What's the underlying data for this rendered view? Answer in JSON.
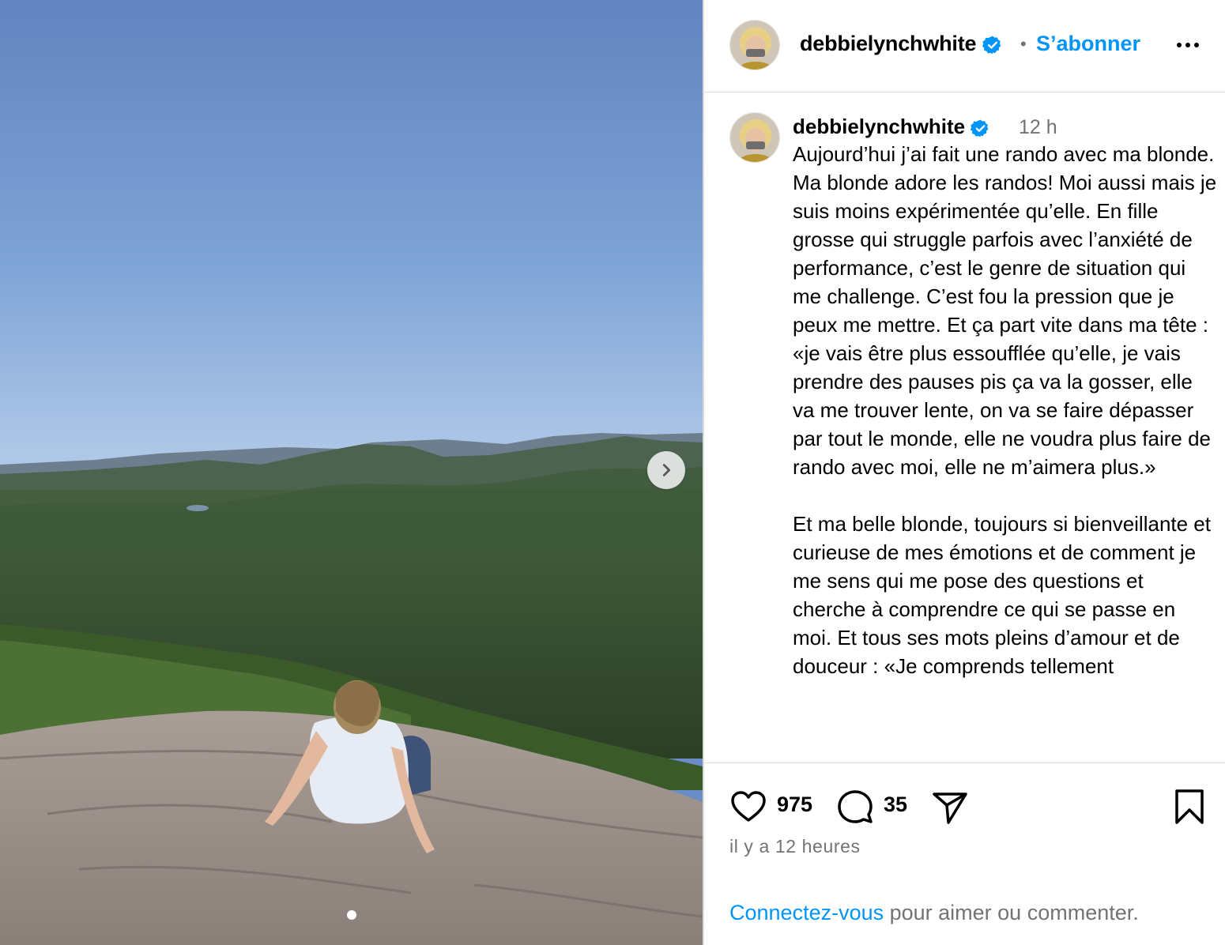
{
  "post": {
    "username": "debbielynchwhite",
    "follow_label": "S’abonner",
    "header_separator": "•",
    "time_short": "12 h",
    "caption_paragraphs": [
      "Aujourd’hui j’ai fait une rando avec ma blonde. Ma blonde adore les randos! Moi aussi mais je suis moins expérimentée qu’elle.  En fille grosse qui struggle parfois avec l’anxiété de performance, c’est le genre de situation qui me challenge. C’est fou la pression que je peux me mettre. Et ça part vite dans ma tête : «je vais être plus essoufflée qu’elle, je vais prendre des pauses pis ça va la gosser, elle va me trouver lente, on va se faire dépasser par tout le monde, elle ne voudra plus faire de rando avec moi, elle ne m’aimera plus.»",
      "Et ma belle blonde, toujours si bienveillante et curieuse de mes émotions et de comment je me sens qui me pose des questions et cherche à comprendre ce qui se passe en moi. Et tous ses mots pleins d’amour et de douceur : «Je comprends tellement"
    ],
    "likes": "975",
    "comments": "35",
    "time_ago": "il y a 12 heures",
    "login_link": "Connectez-vous",
    "login_rest": " pour aimer ou commenter."
  },
  "carousel": {
    "slide_count": 1,
    "active_index": 0
  },
  "colors": {
    "accent": "#0095f6",
    "muted": "#737373",
    "verified": "#0095f6",
    "divider": "#dbdbdb"
  },
  "icons": {
    "next": "chevron-right-icon",
    "verified": "verified-badge-icon",
    "more": "more-horizontal-icon",
    "like": "heart-icon",
    "comment": "comment-icon",
    "share": "share-icon",
    "save": "bookmark-icon"
  }
}
